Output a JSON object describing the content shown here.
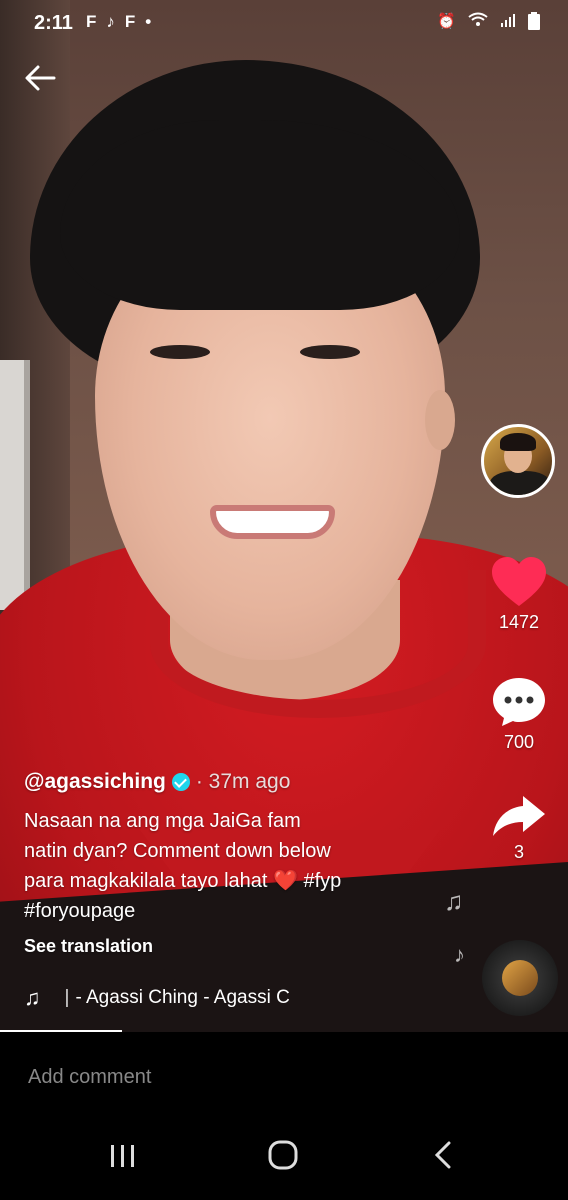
{
  "status_bar": {
    "time": "2:11",
    "app_icons": [
      "F",
      "♪",
      "F",
      "•"
    ],
    "right_icons": [
      "⏰",
      "wifi",
      "▮▮",
      "▮"
    ]
  },
  "actions": {
    "likes": "1472",
    "comments": "700",
    "shares": "3"
  },
  "post": {
    "username": "@agassiching",
    "time_ago": "· 37m ago",
    "caption_line1": "Nasaan na ang mga JaiGa fam",
    "caption_line2": "natin dyan? Comment down below",
    "caption_line3": "para magkakilala tayo lahat ❤️ #fyp",
    "caption_line4": "#foryoupage",
    "see_translation": "See translation",
    "music_label": "- Agassi Ching - Agassi C"
  },
  "comment": {
    "placeholder": "Add comment"
  },
  "nav": {
    "recents": "|||",
    "home": "○",
    "back": "‹"
  },
  "colors": {
    "like": "#fe2c55",
    "verified": "#20d5ec"
  }
}
